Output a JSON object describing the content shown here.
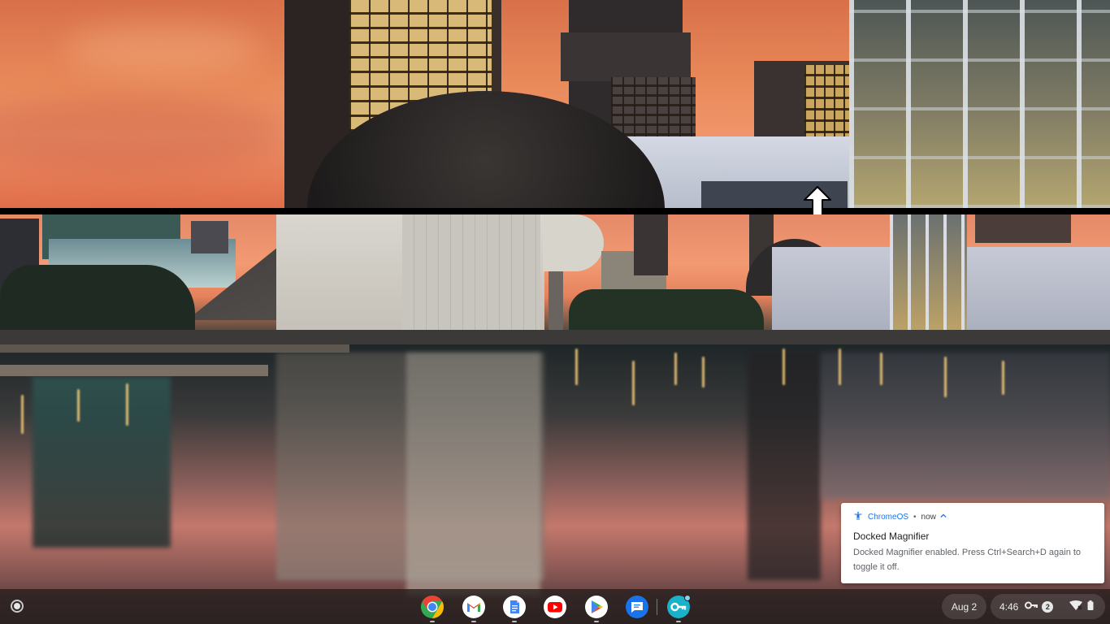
{
  "magnifier": {
    "name": "Docked Magnifier",
    "resize_icon": "vertical-resize-icon"
  },
  "notification": {
    "app_name": "ChromeOS",
    "separator": "•",
    "time": "now",
    "icon": "accessibility-icon",
    "expand_icon": "chevron-up-icon",
    "title": "Docked Magnifier",
    "body": "Docked Magnifier enabled. Press Ctrl+Search+D again to toggle it off."
  },
  "shelf": {
    "launcher_icon": "launcher-icon",
    "apps": [
      {
        "name": "Chrome",
        "icon": "chrome-icon"
      },
      {
        "name": "Gmail",
        "icon": "gmail-icon"
      },
      {
        "name": "Docs",
        "icon": "docs-icon"
      },
      {
        "name": "YouTube",
        "icon": "youtube-icon"
      },
      {
        "name": "Play Store",
        "icon": "play-store-icon"
      },
      {
        "name": "Messages",
        "icon": "messages-icon"
      },
      {
        "name": "Key App",
        "icon": "key-app-icon"
      }
    ],
    "date": "Aug 2",
    "time": "4:46",
    "notification_count": "2",
    "colors": {
      "chrome_red": "#ea4335",
      "chrome_yellow": "#fbbc04",
      "chrome_green": "#34a853",
      "chrome_blue": "#4285f4",
      "youtube_red": "#ff0000",
      "docs_blue": "#4285f4",
      "messages_blue": "#1a73e8",
      "key_app_teal": "#1ab2c9"
    }
  }
}
